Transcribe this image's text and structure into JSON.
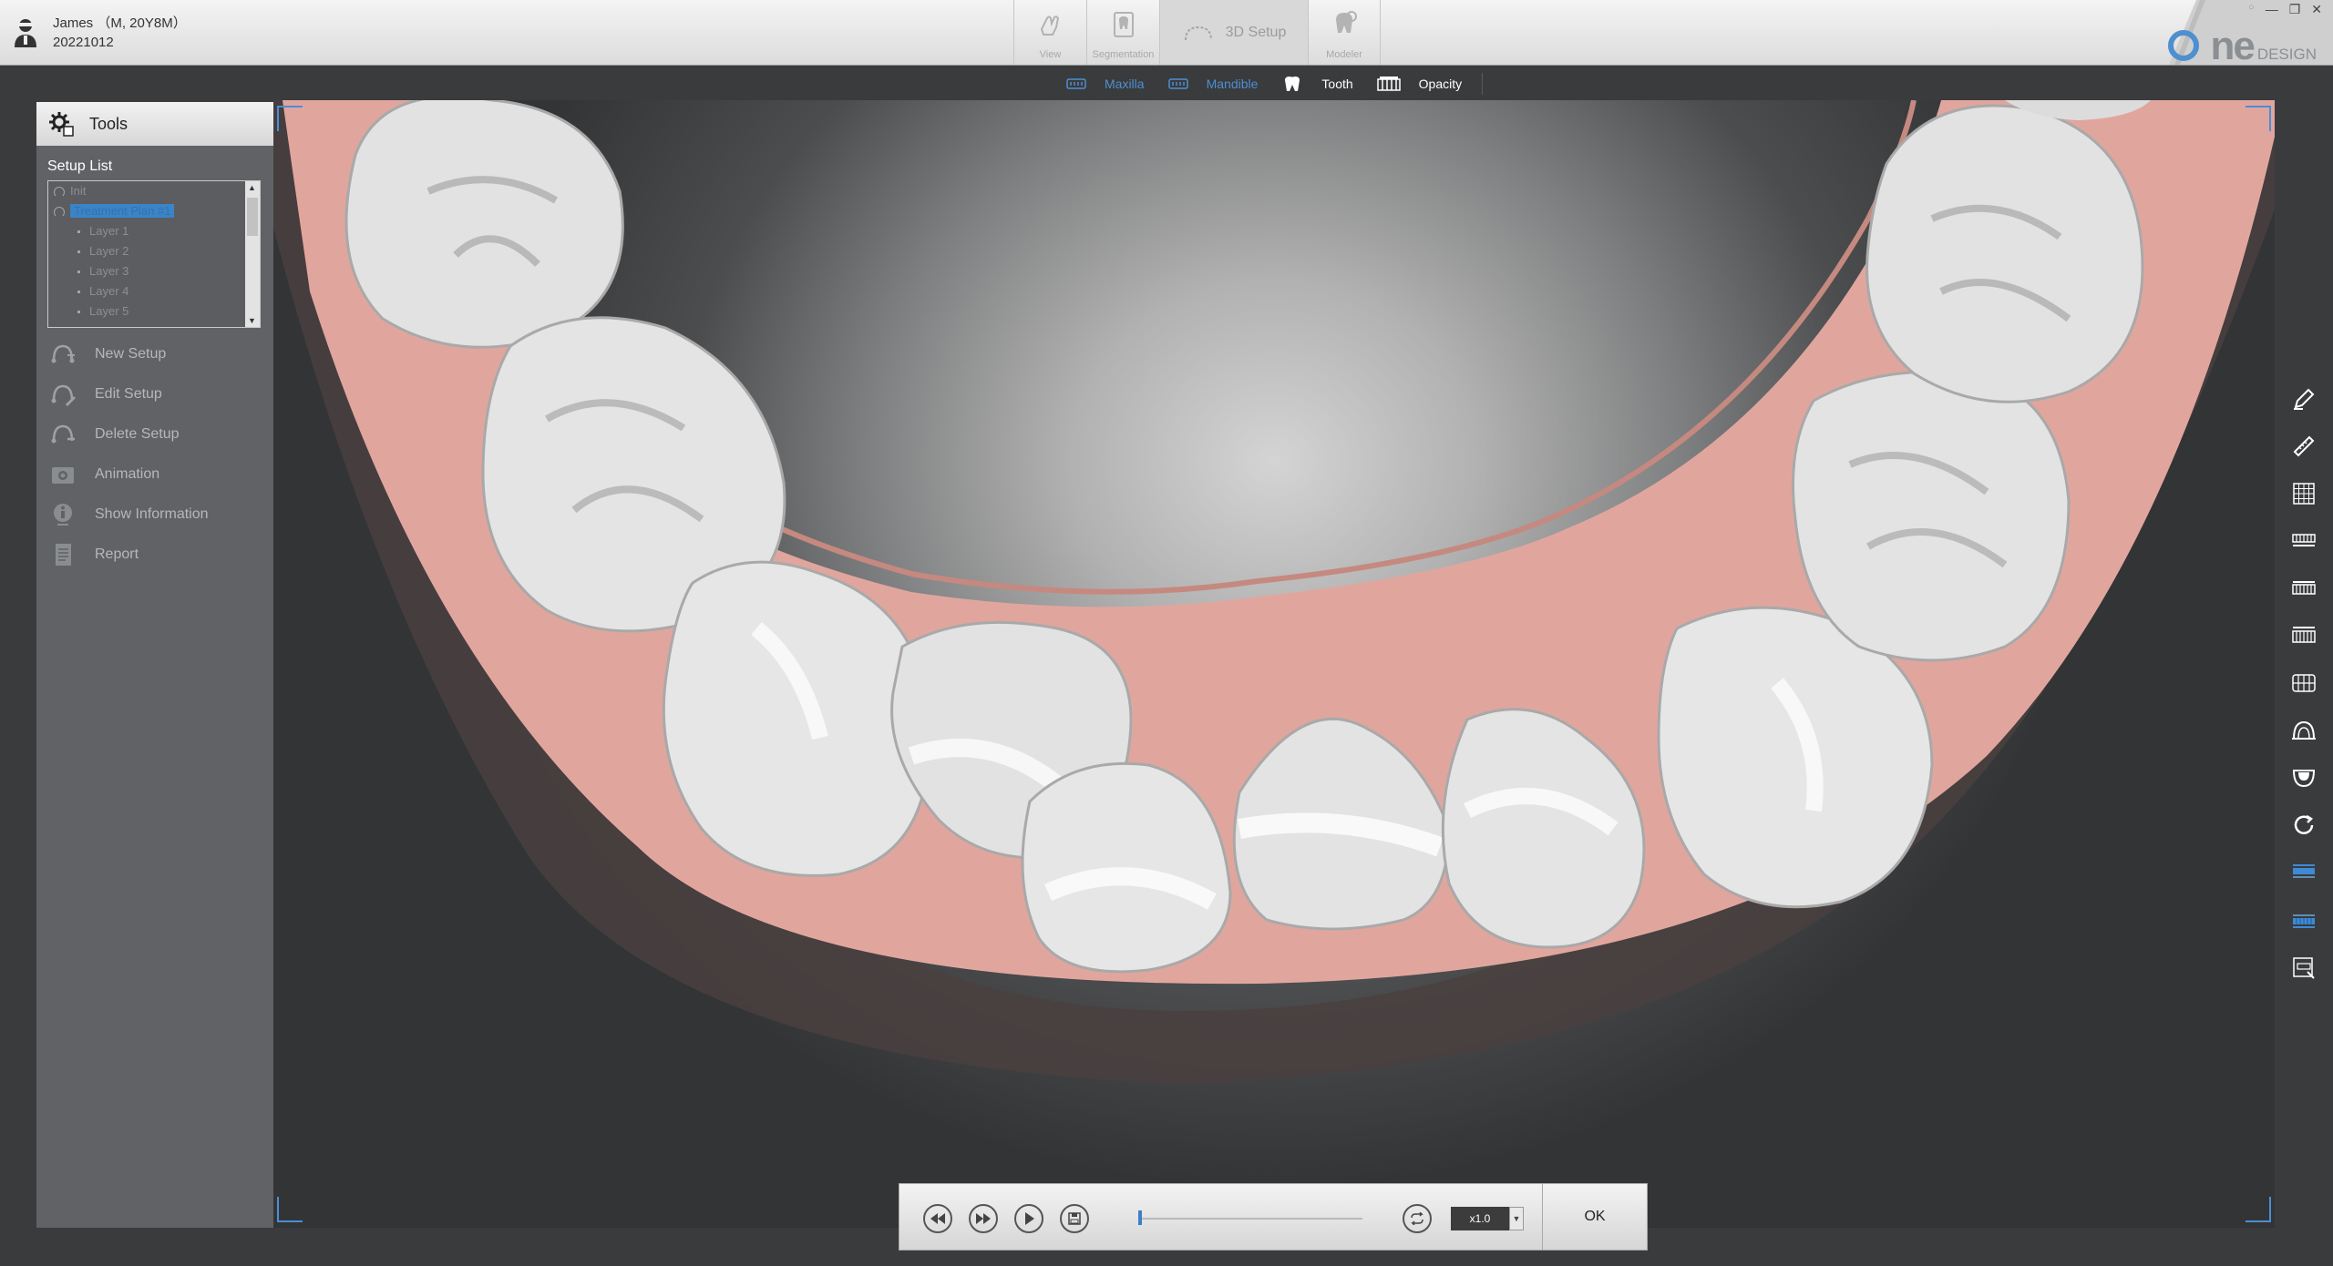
{
  "header": {
    "patient_name": "James （M, 20Y8M）",
    "patient_date": "20221012",
    "modes": [
      {
        "label": "View"
      },
      {
        "label": "Segmentation"
      },
      {
        "label": "3D Setup"
      },
      {
        "label": "Modeler"
      }
    ],
    "logo_main": "ne",
    "logo_sub": "DESIGN",
    "window_controls": [
      "○",
      "—",
      "❐",
      "✕"
    ]
  },
  "subtoolbar": {
    "maxilla": "Maxilla",
    "mandible": "Mandible",
    "tooth": "Tooth",
    "opacity": "Opacity"
  },
  "panel": {
    "title": "Tools",
    "setup_list_label": "Setup List",
    "setup_items": [
      "Init",
      "Treatment Plan #1"
    ],
    "layers": [
      "Layer 1",
      "Layer 2",
      "Layer 3",
      "Layer 4",
      "Layer 5"
    ],
    "menu": [
      {
        "label": "New Setup",
        "icon": "new-setup-icon"
      },
      {
        "label": "Edit Setup",
        "icon": "edit-setup-icon"
      },
      {
        "label": "Delete Setup",
        "icon": "delete-setup-icon"
      },
      {
        "label": "Animation",
        "icon": "animation-icon"
      },
      {
        "label": "Show Information",
        "icon": "info-icon"
      },
      {
        "label": "Report",
        "icon": "report-icon"
      }
    ]
  },
  "playback": {
    "speed": "x1.0",
    "ok_label": "OK",
    "progress": 0
  },
  "colors": {
    "accent": "#3b84c8",
    "gum": "#e3a9a1",
    "tooth": "#e6e6e6"
  }
}
